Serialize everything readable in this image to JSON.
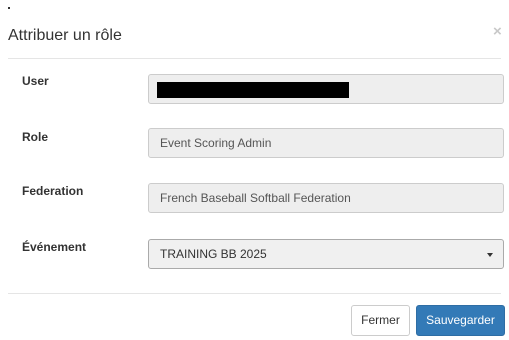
{
  "dialog": {
    "title": "Attribuer un rôle",
    "close_symbol": "×"
  },
  "fields": {
    "user": {
      "label": "User",
      "value": ""
    },
    "role": {
      "label": "Role",
      "value": "Event Scoring Admin"
    },
    "federation": {
      "label": "Federation",
      "value": "French Baseball Softball Federation"
    },
    "event": {
      "label": "Événement",
      "selected": "TRAINING BB 2025"
    }
  },
  "footer": {
    "close_label": "Fermer",
    "save_label": "Sauvegarder"
  },
  "colors": {
    "primary": "#337ab7",
    "readonly_bg": "#eeeeee"
  },
  "icons": {
    "close": "close-icon",
    "dropdown": "caret-down-icon"
  }
}
